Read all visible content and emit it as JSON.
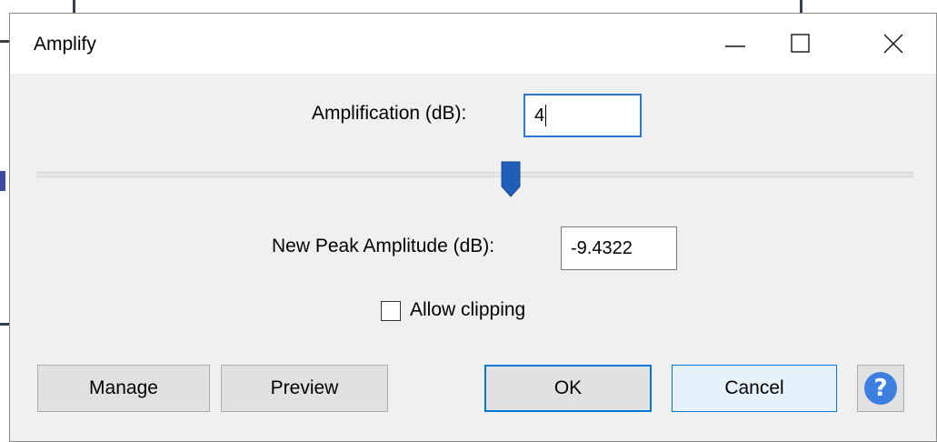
{
  "window": {
    "title": "Amplify",
    "minimize_symbol": "—",
    "maximize_symbol": "☐",
    "close_symbol": "✕"
  },
  "amplification": {
    "label": "Amplification (dB):",
    "value": "4"
  },
  "slider": {
    "value_fraction": 0.54
  },
  "peak": {
    "label": "New Peak Amplitude (dB):",
    "value": "-9.4322"
  },
  "clipping": {
    "label": "Allow clipping",
    "checked": false
  },
  "buttons": {
    "manage": "Manage",
    "preview": "Preview",
    "ok": "OK",
    "cancel": "Cancel",
    "help": "?"
  },
  "colors": {
    "accent": "#0078d7",
    "thumb": "#1f5fb7",
    "help": "#3d7fe0"
  },
  "icons": {
    "minimize": "minimize-icon",
    "maximize": "maximize-icon",
    "close": "close-icon",
    "help": "help-icon"
  }
}
